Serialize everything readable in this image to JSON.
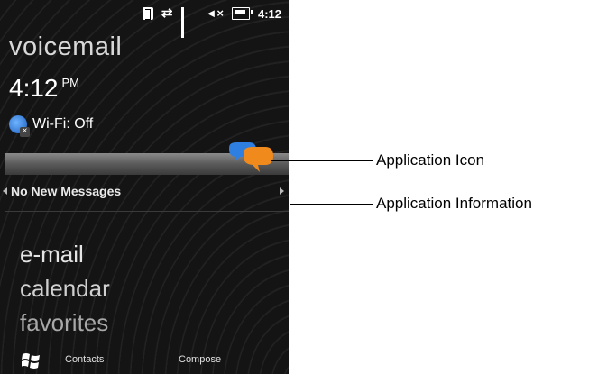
{
  "status_bar": {
    "time": "4:12",
    "icons": [
      "bluetooth-icon",
      "data-sync-icon",
      "signal-strength-icon",
      "volume-muted-icon",
      "battery-icon"
    ]
  },
  "today": {
    "title": "voicemail",
    "clock_time": "4:12",
    "clock_period": "PM",
    "wifi_label": "Wi-Fi: Off",
    "app_info": "No New Messages",
    "menu": [
      "e-mail",
      "calendar",
      "favorites"
    ]
  },
  "softkeys": {
    "left": "Contacts",
    "right": "Compose"
  },
  "callouts": {
    "app_icon": "Application Icon",
    "app_info": "Application Information"
  },
  "colors": {
    "background": "#141414",
    "accent_blue": "#2f7fe0",
    "accent_orange": "#f08a1c"
  }
}
